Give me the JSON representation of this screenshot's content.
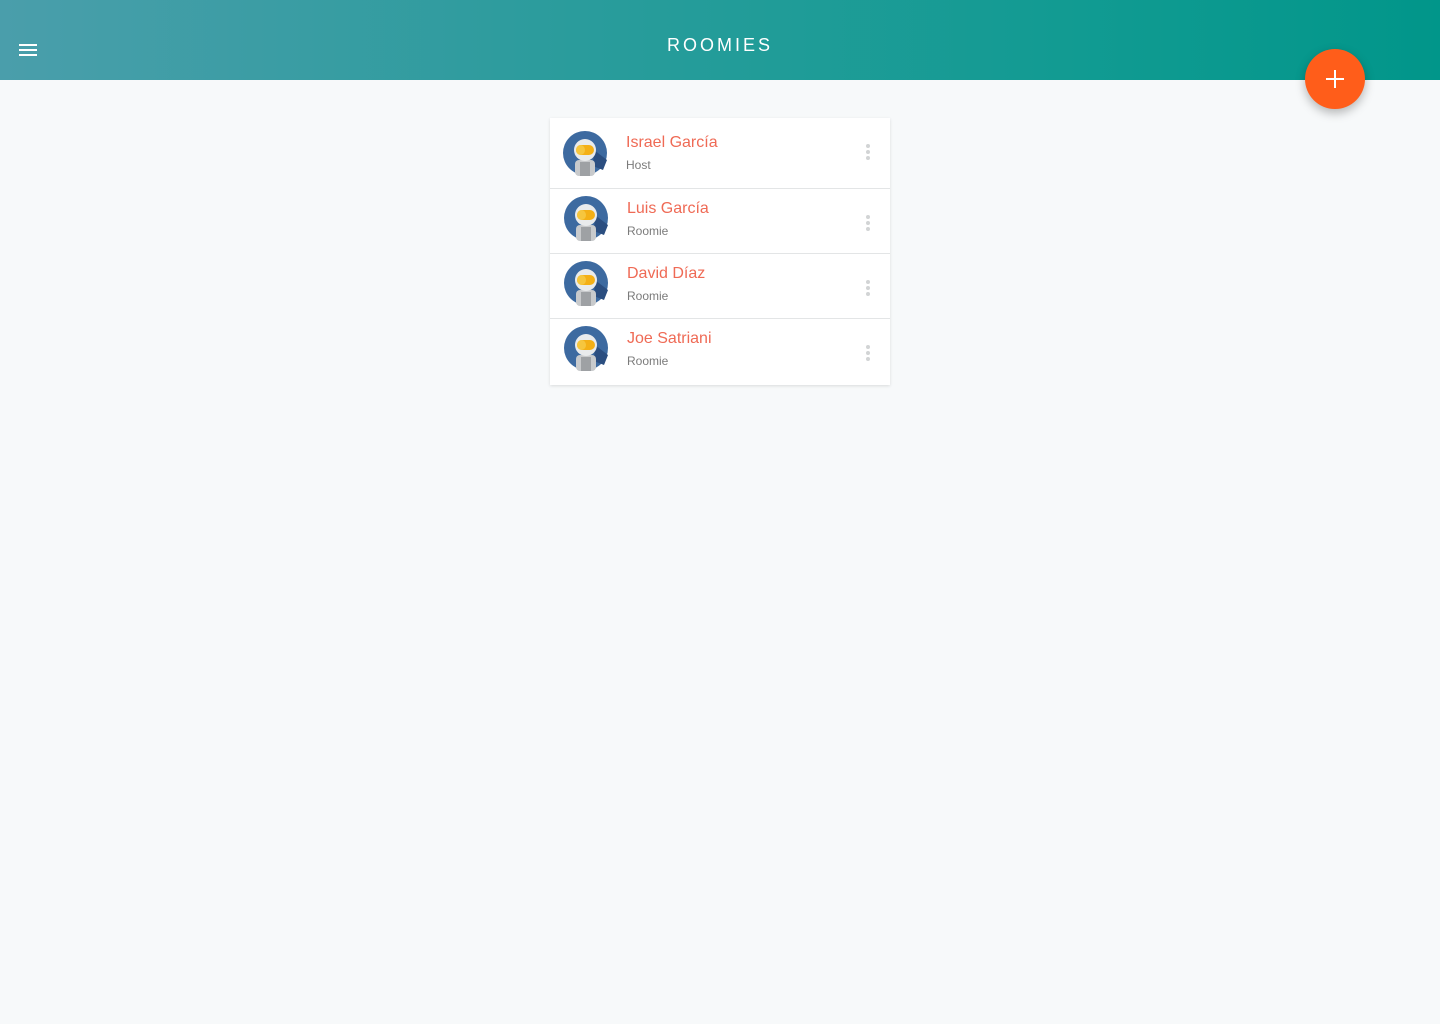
{
  "header": {
    "title": "ROOMIES",
    "menu_icon": "menu-icon",
    "add_icon": "plus-icon"
  },
  "colors": {
    "header_gradient_start": "#4a9eab",
    "header_gradient_end": "#01968a",
    "accent": "#ff5d1a",
    "name_text": "#ef6a55",
    "background": "#f7f9fa"
  },
  "roomies": [
    {
      "name": "Israel García",
      "role": "Host",
      "avatar_icon": "astronaut-avatar-icon"
    },
    {
      "name": "Luis García",
      "role": "Roomie",
      "avatar_icon": "astronaut-avatar-icon"
    },
    {
      "name": "David Díaz",
      "role": "Roomie",
      "avatar_icon": "astronaut-avatar-icon"
    },
    {
      "name": "Joe Satriani",
      "role": "Roomie",
      "avatar_icon": "astronaut-avatar-icon"
    }
  ]
}
